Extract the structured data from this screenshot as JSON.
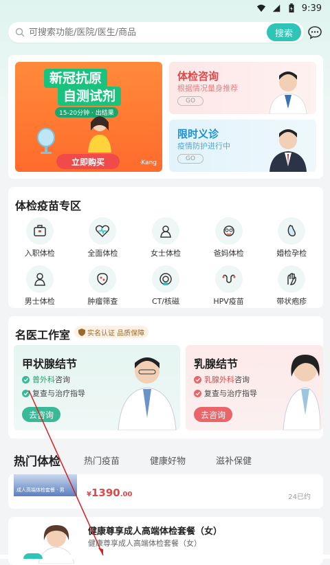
{
  "status": {
    "time": "9:39"
  },
  "search": {
    "placeholder": "可搜索功能/医院/医生/商品",
    "button": "搜索"
  },
  "banner_main": {
    "line1": "新冠抗原",
    "line2": "自测试剂",
    "tag": "15-20分钟 · 出结果",
    "buy": "立即购买",
    "brand": "·Kang"
  },
  "banner_consult": {
    "title": "体检咨询",
    "subtitle": "根据情况量身推荐",
    "go": "GO"
  },
  "banner_clinic": {
    "title": "限时义诊",
    "subtitle": "疫情防护进行中",
    "go": "GO"
  },
  "vaccine": {
    "title": "体检疫苗专区",
    "items": [
      {
        "label": "入职体检",
        "icon": "briefcase-icon"
      },
      {
        "label": "全面体检",
        "icon": "heart-pulse-icon"
      },
      {
        "label": "女士体检",
        "icon": "woman-icon"
      },
      {
        "label": "爸妈体检",
        "icon": "elder-icon"
      },
      {
        "label": "婚检孕检",
        "icon": "pregnancy-icon"
      },
      {
        "label": "男士体检",
        "icon": "man-icon"
      },
      {
        "label": "肿瘤筛查",
        "icon": "tumor-icon"
      },
      {
        "label": "CT/核磁",
        "icon": "ct-scan-icon"
      },
      {
        "label": "HPV疫苗",
        "icon": "uterus-icon"
      },
      {
        "label": "带状疱疹",
        "icon": "rash-icon"
      }
    ]
  },
  "doctors": {
    "title": "名医工作室",
    "badge": "实名认证 品质保障",
    "cards": [
      {
        "title": "甲状腺结节",
        "dept": "普外科",
        "dept_suffix": "咨询",
        "line2": "复查与治疗指导",
        "button": "去咨询"
      },
      {
        "title": "乳腺结节",
        "dept": "乳腺外科",
        "dept_suffix": "咨询",
        "line2": "复查与治疗指导",
        "button": "去咨询"
      }
    ]
  },
  "tabs": [
    "热门体检",
    "热门疫苗",
    "健康好物",
    "滋补保健"
  ],
  "product1": {
    "price_symbol": "¥",
    "price_int": "1390",
    "price_dec": ".00",
    "sold": "24已约",
    "img_caption": "成人高端体检套餐 · 男"
  },
  "product2": {
    "title": "健康尊享成人高端体检套餐（女）",
    "subtitle": "健康尊享成人高端体检套餐（女）"
  },
  "colors": {
    "accent": "#2ec4b6",
    "red": "#e04848",
    "green": "#1aa66c"
  }
}
